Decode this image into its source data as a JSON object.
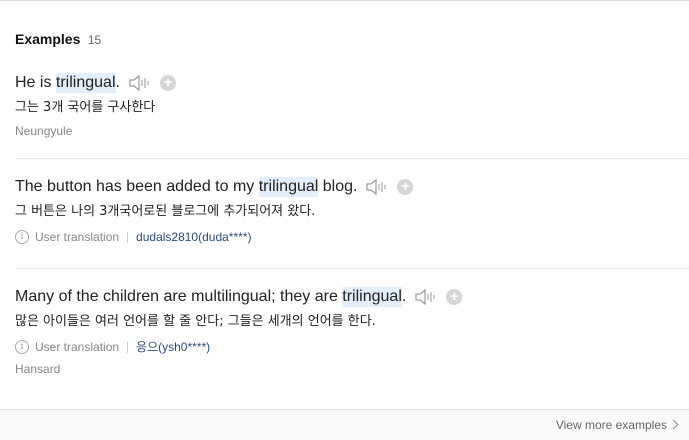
{
  "header": {
    "title": "Examples",
    "count": "15"
  },
  "examples": [
    {
      "pre": "He is ",
      "hl": "trilingual",
      "post": ".",
      "translation": "그는 3개 국어를 구사한다",
      "source": "Neungyule"
    },
    {
      "pre": "The button has been added to my ",
      "hl": "trilingual",
      "post": " blog.",
      "translation": "그 버튼은 나의 3개국어로된 블로그에 추가되어져 왔다.",
      "meta_label": "User translation",
      "user": "dudals2810(duda****)"
    },
    {
      "pre": "Many of the children are multilingual; they are ",
      "hl": "trilingual",
      "post": ".",
      "translation": "많은 아이들은 여러 언어를 할 줄 안다; 그들은 세개의 언어를 한다.",
      "meta_label": "User translation",
      "user": "응으(ysh0****)",
      "source": "Hansard"
    }
  ],
  "footer": {
    "more_label": "View more examples"
  },
  "icons": {
    "speaker": "speaker-icon",
    "add": "plus-icon",
    "info": "info-icon",
    "more": "chevron-right-icon"
  }
}
